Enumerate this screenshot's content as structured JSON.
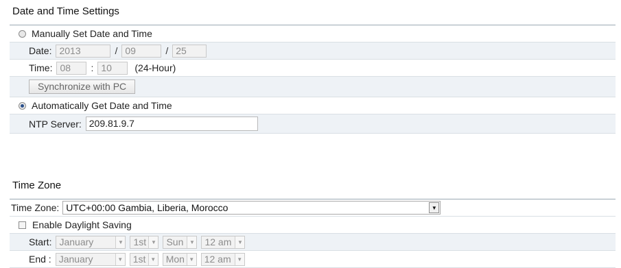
{
  "date_time": {
    "title": "Date and Time Settings",
    "manual_label": "Manually Set Date and Time",
    "date_label": "Date:",
    "year": "2013",
    "month": "09",
    "day": "25",
    "slash": "/",
    "time_label": "Time:",
    "hour": "08",
    "minute": "10",
    "colon": ":",
    "time_format": "(24-Hour)",
    "sync_button": "Synchronize with PC",
    "auto_label": "Automatically Get Date and Time",
    "ntp_label": "NTP Server:",
    "ntp_value": "209.81.9.7"
  },
  "time_zone": {
    "title": "Time Zone",
    "tz_label": "Time Zone:",
    "tz_value": "UTC+00:00 Gambia, Liberia, Morocco",
    "dst_label": "Enable Daylight Saving",
    "start_label": "Start:",
    "start_month": "January",
    "start_week": "1st",
    "start_day": "Sun",
    "start_hour": "12 am",
    "end_label": "End :",
    "end_month": "January",
    "end_week": "1st",
    "end_day": "Mon",
    "end_hour": "12 am"
  },
  "icons": {
    "dropdown": "▼"
  }
}
